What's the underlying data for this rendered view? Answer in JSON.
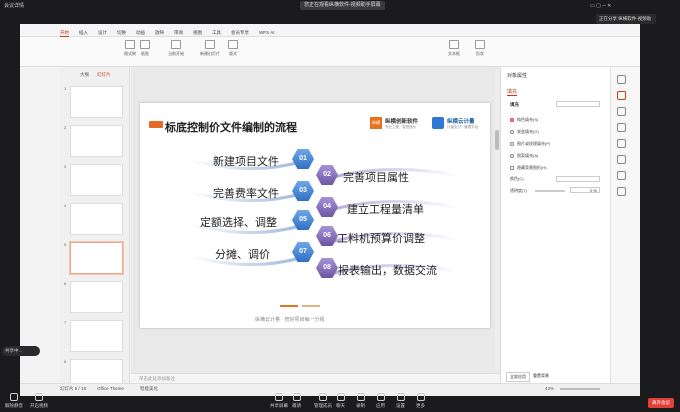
{
  "meeting": {
    "title": "您正在观看纵横软件-视频助手屏幕",
    "left_label": "会议详情",
    "share_status": "正在分享 纵横软件-视频助",
    "end_label": "离开会议",
    "tool_pill": "共享中..."
  },
  "wps": {
    "menu": [
      "开始",
      "插入",
      "设计",
      "切换",
      "动画",
      "放映",
      "审阅",
      "视图",
      "工具",
      "会员专享",
      "WPS AI"
    ],
    "active_menu": "开始",
    "ribbon": [
      "格式刷",
      "粘贴",
      "当前开始",
      "新建幻灯片",
      "版式",
      "节",
      "文本框",
      "形状",
      "排列",
      "图片"
    ],
    "left_tabs": [
      "大纲",
      "幻灯片"
    ],
    "thumb_count": 8,
    "selected_thumb": 5
  },
  "slide": {
    "title": "标底控制价文件编制的流程",
    "logo1_name": "纵横创新软件",
    "logo1_slogan": "专业工程 · 智慧造价",
    "logo2_name": "纵横云计量",
    "logo2_slogan": "计量支付 · 管理平台",
    "steps": [
      {
        "num": "01",
        "label": "新建项目文件"
      },
      {
        "num": "02",
        "label": "完善项目属性"
      },
      {
        "num": "03",
        "label": "完善费率文件"
      },
      {
        "num": "04",
        "label": "建立工程量清单"
      },
      {
        "num": "05",
        "label": "定额选择、调整"
      },
      {
        "num": "06",
        "label": "工料机预算价调整"
      },
      {
        "num": "07",
        "label": "分摊、调价"
      },
      {
        "num": "08",
        "label": "报表输出，数据交流"
      }
    ],
    "footer": "纵横云计量 · 管好项目每一分钱"
  },
  "notes": "单击此处添加备注",
  "right_panel": {
    "title": "对象属性",
    "tab": "填充",
    "section": "填充",
    "options": [
      "纯色填充(S)",
      "渐变填充(G)",
      "图片或纹理填充(P)",
      "图案填充(A)",
      "隐藏背景图形(H)"
    ],
    "selected_option": 0,
    "color_label": "颜色(C)",
    "transparency_label": "透明度(T)",
    "transparency_value": "0 %",
    "apply_all": "全部应用",
    "reset": "重置背景"
  },
  "status": {
    "slide_info": "幻灯片 5 / 18",
    "theme": "Office Theme",
    "zoom": "43%",
    "smart_label": "智能美化"
  },
  "bottom": {
    "items": [
      "解除静音",
      "开启视频",
      "共享屏幕",
      "邀请",
      "管理成员",
      "聊天",
      "录制",
      "应用",
      "设置",
      "更多"
    ]
  }
}
